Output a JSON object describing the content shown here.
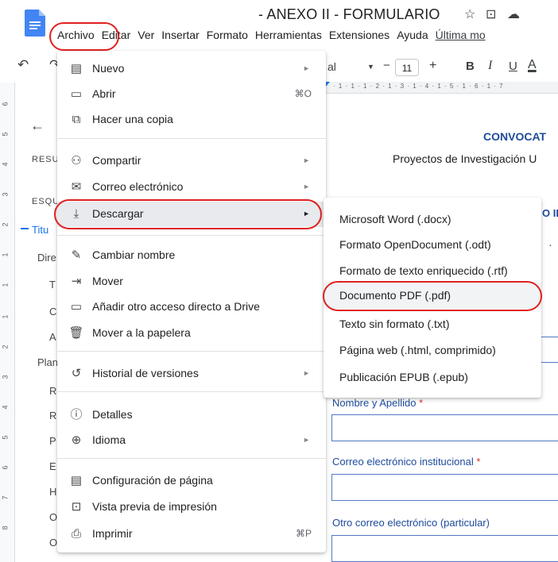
{
  "header": {
    "doc_title": "- ANEXO II - FORMULARIO",
    "star_icon": "star-icon",
    "folder_icon": "move-folder-icon",
    "cloud_icon": "cloud-status-icon"
  },
  "menubar": {
    "items": [
      "Archivo",
      "Editar",
      "Ver",
      "Insertar",
      "Formato",
      "Herramientas",
      "Extensiones",
      "Ayuda"
    ],
    "last_edit": "Última mo"
  },
  "toolbar": {
    "font_fragment": "al",
    "minus": "−",
    "font_size": "11",
    "plus": "+",
    "bold": "B",
    "italic": "I",
    "underline": "U",
    "text_color": "A"
  },
  "ruler": {
    "vertical": [
      "6",
      "5",
      "4",
      "3",
      "2",
      "1",
      "1",
      "1",
      "2",
      "3",
      "4",
      "5",
      "6",
      "7",
      "8"
    ],
    "horizontal": "· 1 · 1 · 1 · 2 · 1 · 3 · 1 · 4 · 1 · 5 · 1 · 6 · 1 · 7"
  },
  "sidebar": {
    "back_arrow": "←",
    "items": [
      "RESU",
      "ESQU",
      "Titu",
      "Dire",
      "T",
      "C",
      "A",
      "Plan",
      "R",
      "R",
      "P",
      "E",
      "H",
      "O",
      "O"
    ]
  },
  "document": {
    "heading": "CONVOCAT",
    "subheading": "Proyectos de Investigación U",
    "section_fragment": "O II",
    "bullet": "·",
    "field_labels": [
      "Nombre y Apellido",
      "Correo electrónico institucional",
      "Otro correo electrónico (particular)"
    ],
    "required_mark": "*"
  },
  "file_menu": {
    "items": [
      {
        "label": "Nuevo",
        "icon": "document-icon",
        "glyph": "▤",
        "arrow": "►"
      },
      {
        "label": "Abrir",
        "icon": "folder-icon",
        "glyph": "▭",
        "shortcut": "⌘O"
      },
      {
        "label": "Hacer una copia",
        "icon": "copy-icon",
        "glyph": "⧉"
      },
      {
        "label": "Compartir",
        "icon": "person-add-icon",
        "glyph": "⚇",
        "arrow": "►"
      },
      {
        "label": "Correo electrónico",
        "icon": "email-icon",
        "glyph": "✉",
        "arrow": "►"
      },
      {
        "label": "Descargar",
        "icon": "download-icon",
        "glyph": "⤓",
        "arrow": "►"
      },
      {
        "label": "Cambiar nombre",
        "icon": "rename-icon",
        "glyph": "✎"
      },
      {
        "label": "Mover",
        "icon": "move-icon",
        "glyph": "⇥"
      },
      {
        "label": "Añadir otro acceso directo a Drive",
        "icon": "drive-shortcut-icon",
        "glyph": "▭"
      },
      {
        "label": "Mover a la papelera",
        "icon": "trash-icon",
        "glyph": "🗑"
      },
      {
        "label": "Historial de versiones",
        "icon": "history-icon",
        "glyph": "↺",
        "arrow": "►"
      },
      {
        "label": "Detalles",
        "icon": "info-icon",
        "glyph": "ⓘ"
      },
      {
        "label": "Idioma",
        "icon": "globe-icon",
        "glyph": "⊕",
        "arrow": "►"
      },
      {
        "label": "Configuración de página",
        "icon": "page-setup-icon",
        "glyph": "▤"
      },
      {
        "label": "Vista previa de impresión",
        "icon": "print-preview-icon",
        "glyph": "⊡"
      },
      {
        "label": "Imprimir",
        "icon": "printer-icon",
        "glyph": "⎙",
        "shortcut": "⌘P"
      }
    ]
  },
  "download_submenu": {
    "items": [
      "Microsoft Word (.docx)",
      "Formato OpenDocument (.odt)",
      "Formato de texto enriquecido (.rtf)",
      "Documento PDF (.pdf)",
      "Texto sin formato (.txt)",
      "Página web (.html, comprimido)",
      "Publicación EPUB (.epub)"
    ]
  },
  "colors": {
    "accent_blue": "#1a73e8",
    "highlight_red": "#e02020",
    "doc_blue": "#1d4b9a"
  }
}
